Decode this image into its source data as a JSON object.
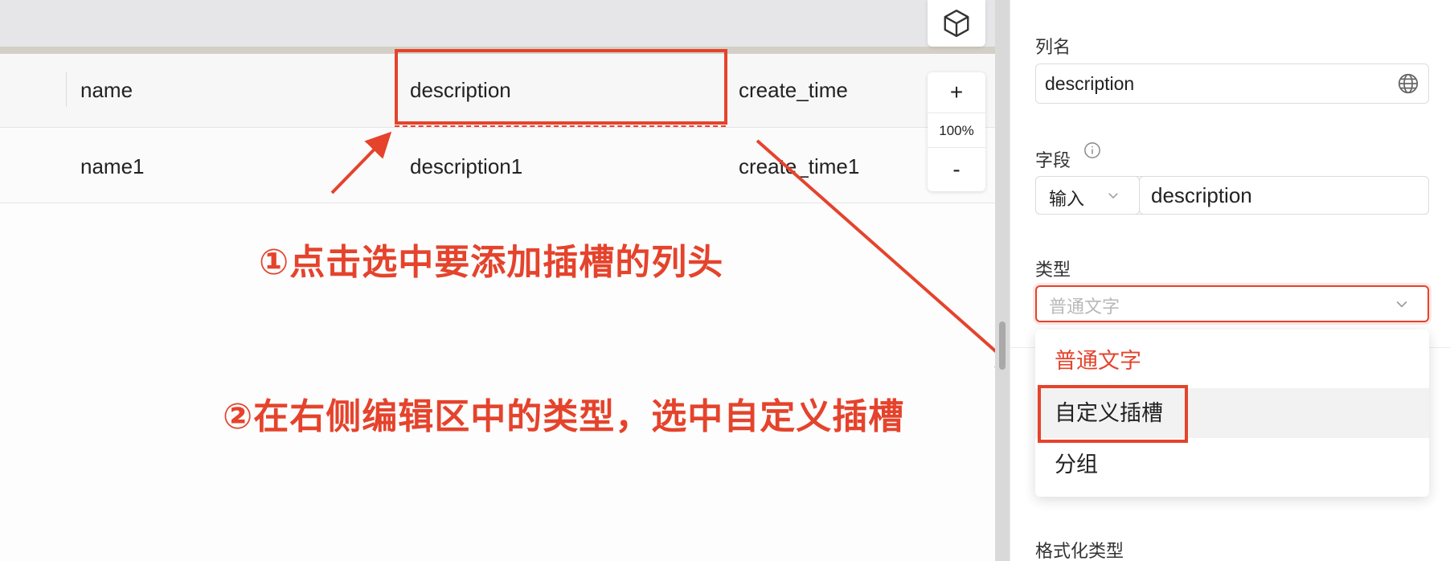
{
  "table": {
    "columns": [
      "name",
      "description",
      "create_time"
    ],
    "rows": [
      [
        "name1",
        "description1",
        "create_time1"
      ]
    ]
  },
  "zoom": {
    "plus": "+",
    "level": "100%",
    "minus": "-"
  },
  "annotations": {
    "step1": "①点击选中要添加插槽的列头",
    "step2": "②在右侧编辑区中的类型，选中自定义插槽"
  },
  "panel": {
    "column_name_label": "列名",
    "column_name_value": "description",
    "field_label": "字段",
    "field_mode": "输入",
    "field_value": "description",
    "type_label": "类型",
    "type_placeholder": "普通文字",
    "type_options": [
      "普通文字",
      "自定义插槽",
      "分组"
    ],
    "format_type_label": "格式化类型"
  },
  "colors": {
    "accent": "#e5432c",
    "annotation": "#e5432c"
  },
  "icons": [
    "cube-icon",
    "globe-icon",
    "info-icon",
    "chevron-down-icon"
  ]
}
